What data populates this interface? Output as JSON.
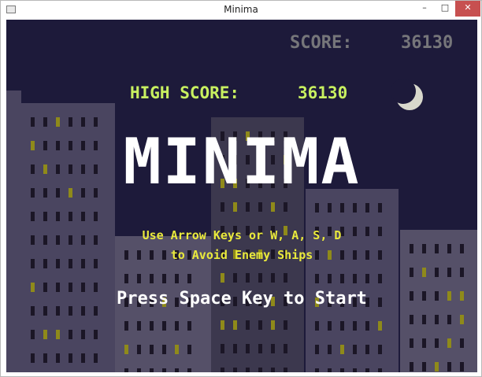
{
  "window": {
    "title": "Minima",
    "controls": {
      "minimize": "–",
      "maximize": "□",
      "close": "✕"
    }
  },
  "hud": {
    "score_label": "SCORE:",
    "score_value": "36130",
    "high_score_label": "HIGH SCORE:",
    "high_score_value": "36130"
  },
  "title_screen": {
    "game_title": "MINIMA",
    "instructions_line1": "Use Arrow Keys or W, A, S, D",
    "instructions_line2": "to Avoid Enemy Ships",
    "start_prompt": "Press Space Key to Start"
  },
  "scene": {
    "sky_color": "#1d1a3a",
    "moon_icon": "crescent-moon-icon",
    "colors": {
      "building_dark": "#3c384e",
      "building_mid": "#4a4560",
      "building_light": "#555068",
      "window_off": "#1b1626",
      "window_lit": "#8f8a1a",
      "moon": "#d8d8cc"
    }
  }
}
